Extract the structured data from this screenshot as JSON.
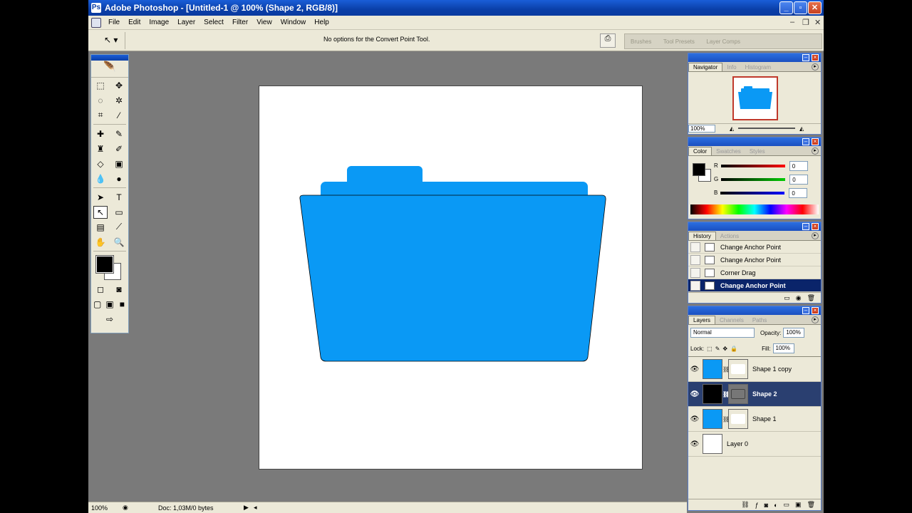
{
  "window": {
    "title": "Adobe Photoshop - [Untitled-1 @ 100% (Shape 2, RGB/8)]"
  },
  "menu": [
    "File",
    "Edit",
    "Image",
    "Layer",
    "Select",
    "Filter",
    "View",
    "Window",
    "Help"
  ],
  "options": {
    "message": "No options for the Convert Point Tool.",
    "wells": [
      "Brushes",
      "Tool Presets",
      "Layer Comps"
    ]
  },
  "status": {
    "zoom": "100%",
    "doc": "Doc: 1,03M/0 bytes"
  },
  "navigator": {
    "tabs": [
      "Navigator",
      "Info",
      "Histogram"
    ],
    "zoom": "100%"
  },
  "color": {
    "tabs": [
      "Color",
      "Swatches",
      "Styles"
    ],
    "channels": [
      {
        "label": "R",
        "value": "0"
      },
      {
        "label": "G",
        "value": "0"
      },
      {
        "label": "B",
        "value": "0"
      }
    ]
  },
  "history": {
    "tabs": [
      "History",
      "Actions"
    ],
    "items": [
      "Change Anchor Point",
      "Change Anchor Point",
      "Corner Drag",
      "Change Anchor Point"
    ],
    "selected": 3
  },
  "layers": {
    "tabs": [
      "Layers",
      "Channels",
      "Paths"
    ],
    "blend": "Normal",
    "opacity_label": "Opacity:",
    "opacity": "100%",
    "lock_label": "Lock:",
    "fill_label": "Fill:",
    "fill": "100%",
    "items": [
      {
        "name": "Shape 1 copy",
        "color": "#0a99f5"
      },
      {
        "name": "Shape 2",
        "color": "#000000"
      },
      {
        "name": "Shape 1",
        "color": "#0a99f5"
      },
      {
        "name": "Layer 0",
        "color": "#ffffff"
      }
    ],
    "selected": 1
  },
  "colors": {
    "folder": "#0a99f5",
    "fg": "#000000",
    "bg": "#ffffff"
  }
}
